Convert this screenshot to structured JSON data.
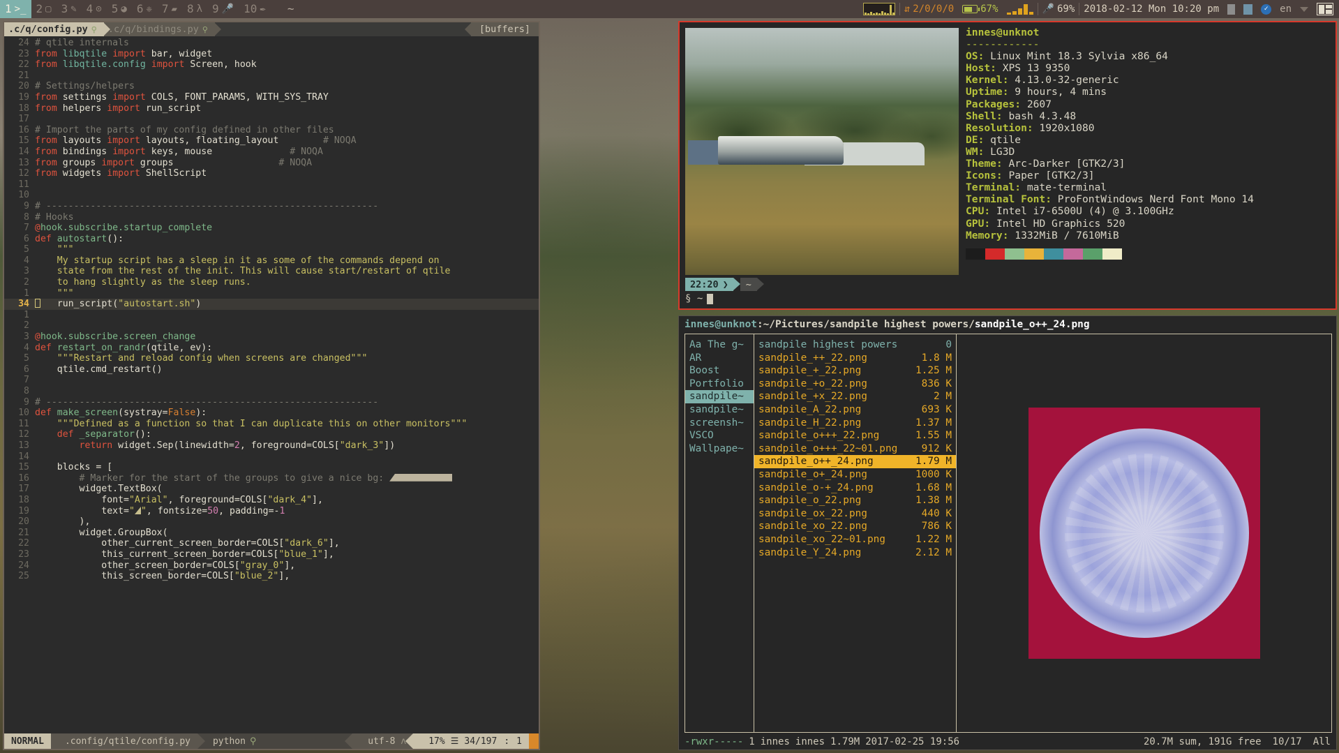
{
  "topbar": {
    "groups": [
      {
        "num": "1",
        "icon": "terminal-icon",
        "glyph": ">_",
        "active": true
      },
      {
        "num": "2",
        "icon": "window-icon",
        "glyph": "▢",
        "active": false
      },
      {
        "num": "3",
        "icon": "pencil-icon",
        "glyph": "✎",
        "active": false
      },
      {
        "num": "4",
        "icon": "github-icon",
        "glyph": "⊙",
        "active": false
      },
      {
        "num": "5",
        "icon": "firefox-icon",
        "glyph": "◕",
        "active": false
      },
      {
        "num": "6",
        "icon": "python-icon",
        "glyph": "❈",
        "active": false
      },
      {
        "num": "7",
        "icon": "folder-icon",
        "glyph": "▰",
        "active": false
      },
      {
        "num": "8",
        "icon": "lambda-icon",
        "glyph": "λ",
        "active": false
      },
      {
        "num": "9",
        "icon": "microphone-icon",
        "glyph": "🎤",
        "active": false
      },
      {
        "num": "10",
        "icon": "steam-icon",
        "glyph": "✒",
        "active": false
      }
    ],
    "window_name": "~",
    "net": "2/0/0/0",
    "battery": "67%",
    "volume": "69%",
    "clock": "2018-02-12 Mon 10:20 pm",
    "keyboard_layout": "en"
  },
  "vim": {
    "tabs": [
      {
        "label": ".c/q/config.py",
        "modified": "⚲",
        "selected": true
      },
      {
        "label": ".c/q/bindings.py",
        "modified": "⚲",
        "selected": false
      }
    ],
    "buffers_label": "[buffers]",
    "lines": [
      {
        "n": "24",
        "cur": false,
        "html": "<span class='cmt'># qtile internals</span>"
      },
      {
        "n": "23",
        "cur": false,
        "html": "<span class='kw'>from</span> <span class='mod-name'>libqtile</span> <span class='kw'>import</span> <span class='ident'>bar, widget</span>"
      },
      {
        "n": "22",
        "cur": false,
        "html": "<span class='kw'>from</span> <span class='mod-name'>libqtile.config</span> <span class='kw'>import</span> <span class='ident'>Screen, hook</span>"
      },
      {
        "n": "21",
        "cur": false,
        "html": ""
      },
      {
        "n": "20",
        "cur": false,
        "html": "<span class='cmt'># Settings/helpers</span>"
      },
      {
        "n": "19",
        "cur": false,
        "html": "<span class='kw'>from</span> <span class='ident'>settings</span> <span class='kw'>import</span> <span class='ident'>COLS, FONT_PARAMS, WITH_SYS_TRAY</span>"
      },
      {
        "n": "18",
        "cur": false,
        "html": "<span class='kw'>from</span> <span class='ident'>helpers</span> <span class='kw'>import</span> <span class='ident'>run_script</span>"
      },
      {
        "n": "17",
        "cur": false,
        "html": ""
      },
      {
        "n": "16",
        "cur": false,
        "html": "<span class='cmt'># Import the parts of my config defined in other files</span>"
      },
      {
        "n": "15",
        "cur": false,
        "html": "<span class='kw'>from</span> <span class='ident'>layouts</span> <span class='kw'>import</span> <span class='ident'>layouts, floating_layout</span>        <span class='cmt'># NOQA</span>"
      },
      {
        "n": "14",
        "cur": false,
        "html": "<span class='kw'>from</span> <span class='ident'>bindings</span> <span class='kw'>import</span> <span class='ident'>keys, mouse</span>              <span class='cmt'># NOQA</span>"
      },
      {
        "n": "13",
        "cur": false,
        "html": "<span class='kw'>from</span> <span class='ident'>groups</span> <span class='kw'>import</span> <span class='ident'>groups</span>                   <span class='cmt'># NOQA</span>"
      },
      {
        "n": "12",
        "cur": false,
        "html": "<span class='kw'>from</span> <span class='ident'>widgets</span> <span class='kw'>import</span> <span class='ident'>ShellScript</span>"
      },
      {
        "n": "11",
        "cur": false,
        "html": ""
      },
      {
        "n": "10",
        "cur": false,
        "html": ""
      },
      {
        "n": "9",
        "cur": false,
        "html": "<span class='cmt'># ------------------------------------------------------------</span>"
      },
      {
        "n": "8",
        "cur": false,
        "html": "<span class='cmt'># Hooks</span>"
      },
      {
        "n": "7",
        "cur": false,
        "html": "<span class='deco'>@</span><span class='fn'>hook.subscribe.startup_complete</span>"
      },
      {
        "n": "6",
        "cur": false,
        "html": "<span class='kw'>def</span> <span class='fn'>autostart</span><span class='ident'>():</span>"
      },
      {
        "n": "5",
        "cur": false,
        "html": "    <span class='str'>\"\"\"</span>"
      },
      {
        "n": "4",
        "cur": false,
        "html": "    <span class='str'>My startup script has a sleep in it as some of the commands depend on</span>"
      },
      {
        "n": "3",
        "cur": false,
        "html": "    <span class='str'>state from the rest of the init. This will cause start/restart of qtile</span>"
      },
      {
        "n": "2",
        "cur": false,
        "html": "    <span class='str'>to hang slightly as the sleep runs.</span>"
      },
      {
        "n": "1",
        "cur": false,
        "html": "    <span class='str'>\"\"\"</span>"
      },
      {
        "n": "34",
        "cur": true,
        "html": "<span class='cursor-blk'></span>   <span class='ident'>run_script</span><span class='ident'>(</span><span class='str'>\"autostart.sh\"</span><span class='ident'>)</span>"
      },
      {
        "n": "1",
        "cur": false,
        "html": ""
      },
      {
        "n": "2",
        "cur": false,
        "html": ""
      },
      {
        "n": "3",
        "cur": false,
        "html": "<span class='deco'>@</span><span class='fn'>hook.subscribe.screen_change</span>"
      },
      {
        "n": "4",
        "cur": false,
        "html": "<span class='kw'>def</span> <span class='fn'>restart_on_randr</span><span class='ident'>(</span><span class='ident'>qtile, ev</span><span class='ident'>):</span>"
      },
      {
        "n": "5",
        "cur": false,
        "html": "    <span class='str'>\"\"\"Restart and reload config when screens are changed\"\"\"</span>"
      },
      {
        "n": "6",
        "cur": false,
        "html": "    <span class='ident'>qtile.cmd_restart()</span>"
      },
      {
        "n": "7",
        "cur": false,
        "html": ""
      },
      {
        "n": "8",
        "cur": false,
        "html": ""
      },
      {
        "n": "9",
        "cur": false,
        "html": "<span class='cmt'># ------------------------------------------------------------</span>"
      },
      {
        "n": "10",
        "cur": false,
        "html": "<span class='kw'>def</span> <span class='fn'>make_screen</span><span class='ident'>(</span><span class='ident'>systray=</span><span class='orange'>False</span><span class='ident'>):</span>"
      },
      {
        "n": "11",
        "cur": false,
        "html": "    <span class='str'>\"\"\"Defined as a function so that I can duplicate this on other monitors\"\"\"</span>"
      },
      {
        "n": "12",
        "cur": false,
        "html": "    <span class='kw'>def</span> <span class='fn'>_separator</span><span class='ident'>():</span>"
      },
      {
        "n": "13",
        "cur": false,
        "html": "        <span class='kw'>return</span> <span class='ident'>widget.Sep(linewidth=</span><span class='num'>2</span><span class='ident'>, foreground=COLS[</span><span class='str'>\"dark_3\"</span><span class='ident'>])</span>"
      },
      {
        "n": "14",
        "cur": false,
        "html": ""
      },
      {
        "n": "15",
        "cur": false,
        "html": "    <span class='ident'>blocks = [</span>"
      },
      {
        "n": "16",
        "cur": false,
        "html": "        <span class='cmt'># Marker for the start of the groups to give a nice bg:</span> <span class='marker'></span>"
      },
      {
        "n": "17",
        "cur": false,
        "html": "        <span class='ident'>widget.TextBox(</span>"
      },
      {
        "n": "18",
        "cur": false,
        "html": "            <span class='ident'>font=</span><span class='str'>\"Arial\"</span><span class='ident'>, foreground=COLS[</span><span class='str'>\"dark_4\"</span><span class='ident'>],</span>"
      },
      {
        "n": "19",
        "cur": false,
        "html": "            <span class='ident'>text=</span><span class='str'>\"</span><span class='tri'></span><span class='str'>\"</span><span class='ident'>, fontsize=</span><span class='num'>50</span><span class='ident'>, padding=-</span><span class='num'>1</span>"
      },
      {
        "n": "20",
        "cur": false,
        "html": "        <span class='ident'>),</span>"
      },
      {
        "n": "21",
        "cur": false,
        "html": "        <span class='ident'>widget.GroupBox(</span>"
      },
      {
        "n": "22",
        "cur": false,
        "html": "            <span class='ident'>other_current_screen_border=COLS[</span><span class='str'>\"dark_6\"</span><span class='ident'>],</span>"
      },
      {
        "n": "23",
        "cur": false,
        "html": "            <span class='ident'>this_current_screen_border=COLS[</span><span class='str'>\"blue_1\"</span><span class='ident'>],</span>"
      },
      {
        "n": "24",
        "cur": false,
        "html": "            <span class='ident'>other_screen_border=COLS[</span><span class='str'>\"gray_0\"</span><span class='ident'>],</span>"
      },
      {
        "n": "25",
        "cur": false,
        "html": "            <span class='ident'>this_screen_border=COLS[</span><span class='str'>\"blue_2\"</span><span class='ident'>],</span>"
      }
    ],
    "status": {
      "mode": "NORMAL",
      "file": ".config/qtile/config.py",
      "filetype": "python",
      "filetype_icon": "⚲",
      "encoding": "utf-8",
      "encoding_icon": "ʌ",
      "percent": "17%",
      "percent_icon": "☰",
      "position": "34/197",
      "colsep": ":",
      "col": "1"
    }
  },
  "terminal": {
    "neofetch": {
      "user_host": "innes@unknot",
      "divider": "------------",
      "rows": [
        {
          "key": "OS:",
          "value": "Linux Mint 18.3 Sylvia x86_64"
        },
        {
          "key": "Host:",
          "value": "XPS 13 9350"
        },
        {
          "key": "Kernel:",
          "value": "4.13.0-32-generic"
        },
        {
          "key": "Uptime:",
          "value": "9 hours, 4 mins"
        },
        {
          "key": "Packages:",
          "value": "2607"
        },
        {
          "key": "Shell:",
          "value": "bash 4.3.48"
        },
        {
          "key": "Resolution:",
          "value": "1920x1080"
        },
        {
          "key": "DE:",
          "value": "qtile"
        },
        {
          "key": "WM:",
          "value": "LG3D"
        },
        {
          "key": "Theme:",
          "value": "Arc-Darker [GTK2/3]"
        },
        {
          "key": "Icons:",
          "value": "Paper [GTK2/3]"
        },
        {
          "key": "Terminal:",
          "value": "mate-terminal"
        },
        {
          "key": "Terminal Font:",
          "value": "ProFontWindows Nerd Font Mono 14"
        },
        {
          "key": "CPU:",
          "value": "Intel i7-6500U (4) @ 3.100GHz"
        },
        {
          "key": "GPU:",
          "value": "Intel HD Graphics 520"
        },
        {
          "key": "Memory:",
          "value": "1332MiB / 7610MiB"
        }
      ],
      "palette": [
        "#1c1c1c",
        "#d42a2a",
        "#8fc08f",
        "#e8b33a",
        "#3f8f9e",
        "#c4699b",
        "#5aa06a",
        "#f0ecc8"
      ]
    },
    "prompt": {
      "time": "22:20",
      "icon": "terminal-icon",
      "path": "~",
      "second_line": "§ ~"
    }
  },
  "ranger": {
    "title_user": "innes@unknot",
    "title_path": ":~/Pictures/sandpile highest powers/",
    "title_file": "sandpile_o++_24.png",
    "parent_column": [
      {
        "name": "Aa The g~",
        "selected": false
      },
      {
        "name": "AR",
        "selected": false
      },
      {
        "name": "Boost",
        "selected": false
      },
      {
        "name": "Portfolio",
        "selected": false
      },
      {
        "name": "sandpile~",
        "selected": true
      },
      {
        "name": "sandpile~",
        "selected": false
      },
      {
        "name": "screensh~",
        "selected": false
      },
      {
        "name": "VSCO",
        "selected": false
      },
      {
        "name": "Wallpape~",
        "selected": false
      }
    ],
    "files": [
      {
        "name": "sandpile highest powers",
        "size": "0",
        "type": "dir",
        "cursor": false
      },
      {
        "name": "sandpile_++_22.png",
        "size": "1.8 M",
        "type": "file",
        "cursor": false
      },
      {
        "name": "sandpile_+_22.png",
        "size": "1.25 M",
        "type": "file",
        "cursor": false
      },
      {
        "name": "sandpile_+o_22.png",
        "size": "836 K",
        "type": "file",
        "cursor": false
      },
      {
        "name": "sandpile_+x_22.png",
        "size": "2 M",
        "type": "file",
        "cursor": false
      },
      {
        "name": "sandpile_A_22.png",
        "size": "693 K",
        "type": "file",
        "cursor": false
      },
      {
        "name": "sandpile_H_22.png",
        "size": "1.37 M",
        "type": "file",
        "cursor": false
      },
      {
        "name": "sandpile_o+++_22.png",
        "size": "1.55 M",
        "type": "file",
        "cursor": false
      },
      {
        "name": "sandpile_o+++_22~01.png",
        "size": "912 K",
        "type": "file",
        "cursor": false
      },
      {
        "name": "sandpile_o++_24.png",
        "size": "1.79 M",
        "type": "file",
        "cursor": true
      },
      {
        "name": "sandpile_o+_24.png",
        "size": "1000 K",
        "type": "file",
        "cursor": false
      },
      {
        "name": "sandpile_o-+_24.png",
        "size": "1.68 M",
        "type": "file",
        "cursor": false
      },
      {
        "name": "sandpile_o_22.png",
        "size": "1.38 M",
        "type": "file",
        "cursor": false
      },
      {
        "name": "sandpile_ox_22.png",
        "size": "440 K",
        "type": "file",
        "cursor": false
      },
      {
        "name": "sandpile_xo_22.png",
        "size": "786 K",
        "type": "file",
        "cursor": false
      },
      {
        "name": "sandpile_xo_22~01.png",
        "size": "1.22 M",
        "type": "file",
        "cursor": false
      },
      {
        "name": "sandpile_Y_24.png",
        "size": "2.12 M",
        "type": "file",
        "cursor": false
      }
    ],
    "status": {
      "permissions": "-rwxr-----",
      "links": "1",
      "owner": "innes",
      "group": "innes",
      "size": "1.79M",
      "date": "2017-02-25 19:56",
      "sum": "20.7M sum, 191G free",
      "index": "10/17",
      "scroll": "All"
    }
  }
}
